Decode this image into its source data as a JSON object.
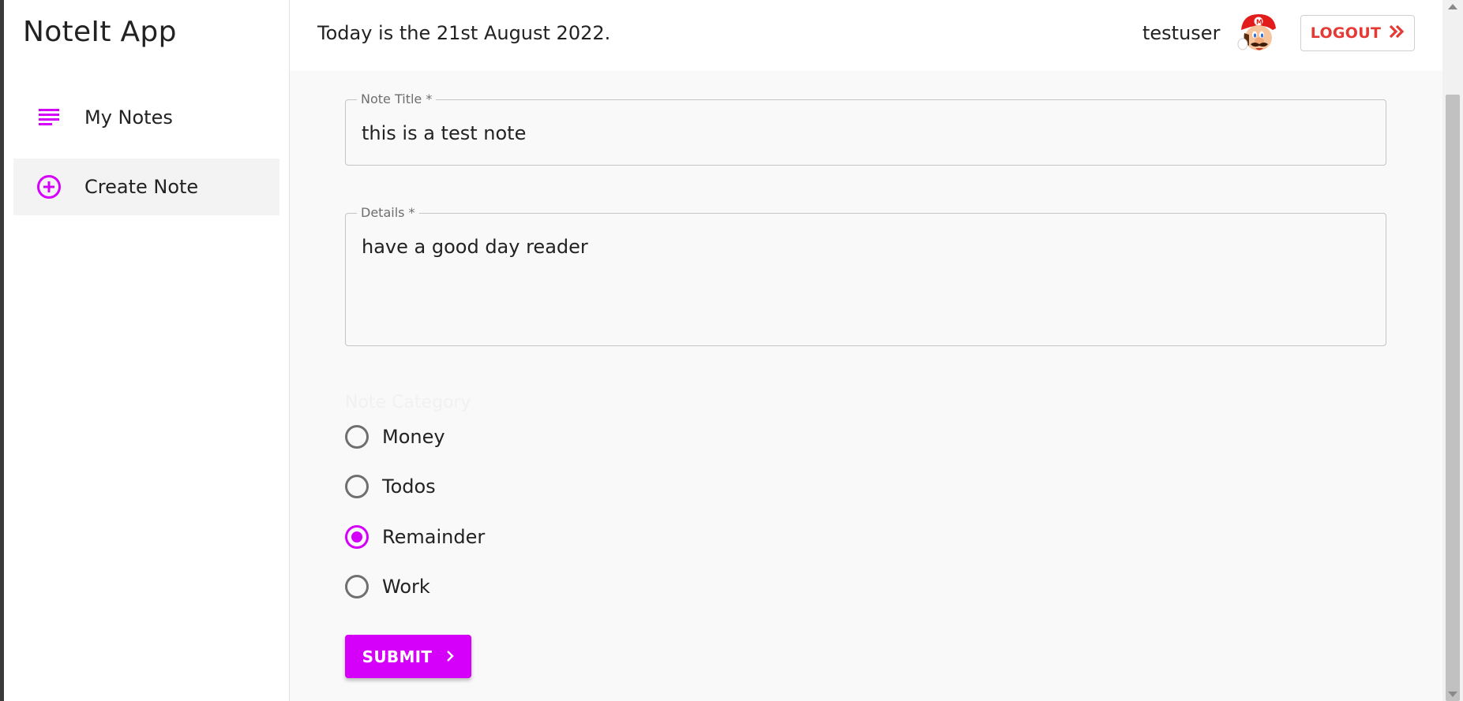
{
  "app": {
    "title": "NoteIt App"
  },
  "sidebar": {
    "items": [
      {
        "label": "My Notes",
        "icon": "subject-lines-icon"
      },
      {
        "label": "Create Note",
        "icon": "add-circle-icon"
      }
    ]
  },
  "header": {
    "date_text": "Today is the 21st August 2022.",
    "username": "testuser",
    "logout_label": "LOGOUT"
  },
  "form": {
    "title_field": {
      "label": "Note Title *",
      "value": "this is a test note"
    },
    "details_field": {
      "label": "Details *",
      "value": "have a good day reader"
    },
    "category": {
      "label": "Note Category",
      "options": [
        "Money",
        "Todos",
        "Remainder",
        "Work"
      ],
      "selected": "Remainder"
    },
    "submit_label": "SUBMIT"
  },
  "colors": {
    "accent": "#d500f9",
    "logout": "#e53935",
    "text": "#222222"
  }
}
